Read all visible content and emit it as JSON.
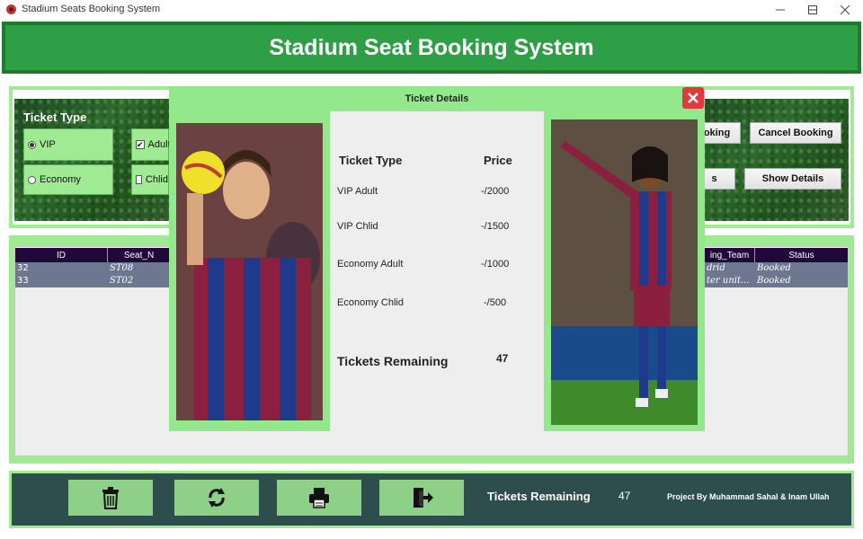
{
  "window": {
    "title": "Stadium Seats Booking System",
    "app_icon": "app-logo-icon",
    "controls": [
      "minimize-icon",
      "maximize-icon",
      "close-icon"
    ]
  },
  "header": {
    "title": "Stadium Seat Booking System"
  },
  "ticket_type": {
    "title": "Ticket Type",
    "options": [
      {
        "label": "VIP",
        "selected": true
      },
      {
        "label": "Economy",
        "selected": false
      }
    ],
    "age": [
      {
        "label": "Adult",
        "checked": true
      },
      {
        "label": "Chlid",
        "checked": false
      }
    ]
  },
  "actions": {
    "booking_label": "oking",
    "cancel_label": "Cancel Booking",
    "hidden_label": "s",
    "show_details_label": "Show Details"
  },
  "table": {
    "columns": [
      "ID",
      "Seat_N",
      "ing_Team",
      "Status"
    ],
    "rows": [
      {
        "id": "32",
        "seat": "ST08",
        "team": "drid",
        "status": "Booked"
      },
      {
        "id": "33",
        "seat": "ST02",
        "team": "ter unit...",
        "status": "Booked"
      }
    ]
  },
  "dialog": {
    "title": "Ticket Details",
    "header_type": "Ticket Type",
    "header_price": "Price",
    "prices": [
      {
        "type": "VIP Adult",
        "price": "-/2000"
      },
      {
        "type": "VIP Chlid",
        "price": "-/1500"
      },
      {
        "type": "Economy Adult",
        "price": "-/1000"
      },
      {
        "type": "Economy Chlid",
        "price": "-/500"
      }
    ],
    "remaining_label": "Tickets Remaining",
    "remaining_value": "47"
  },
  "footer": {
    "tools": [
      "trash-icon",
      "refresh-icon",
      "printer-icon",
      "exit-icon"
    ],
    "remaining_label": "Tickets Remaining",
    "remaining_value": "47",
    "credit": "Project By Muhammad Sahal & Inam Ullah"
  },
  "colors": {
    "header_green": "#2e9e47",
    "panel_green": "#a1ea94",
    "footer_teal": "#2e4d4d",
    "table_header": "#20093a",
    "close_red": "#e0393e"
  }
}
